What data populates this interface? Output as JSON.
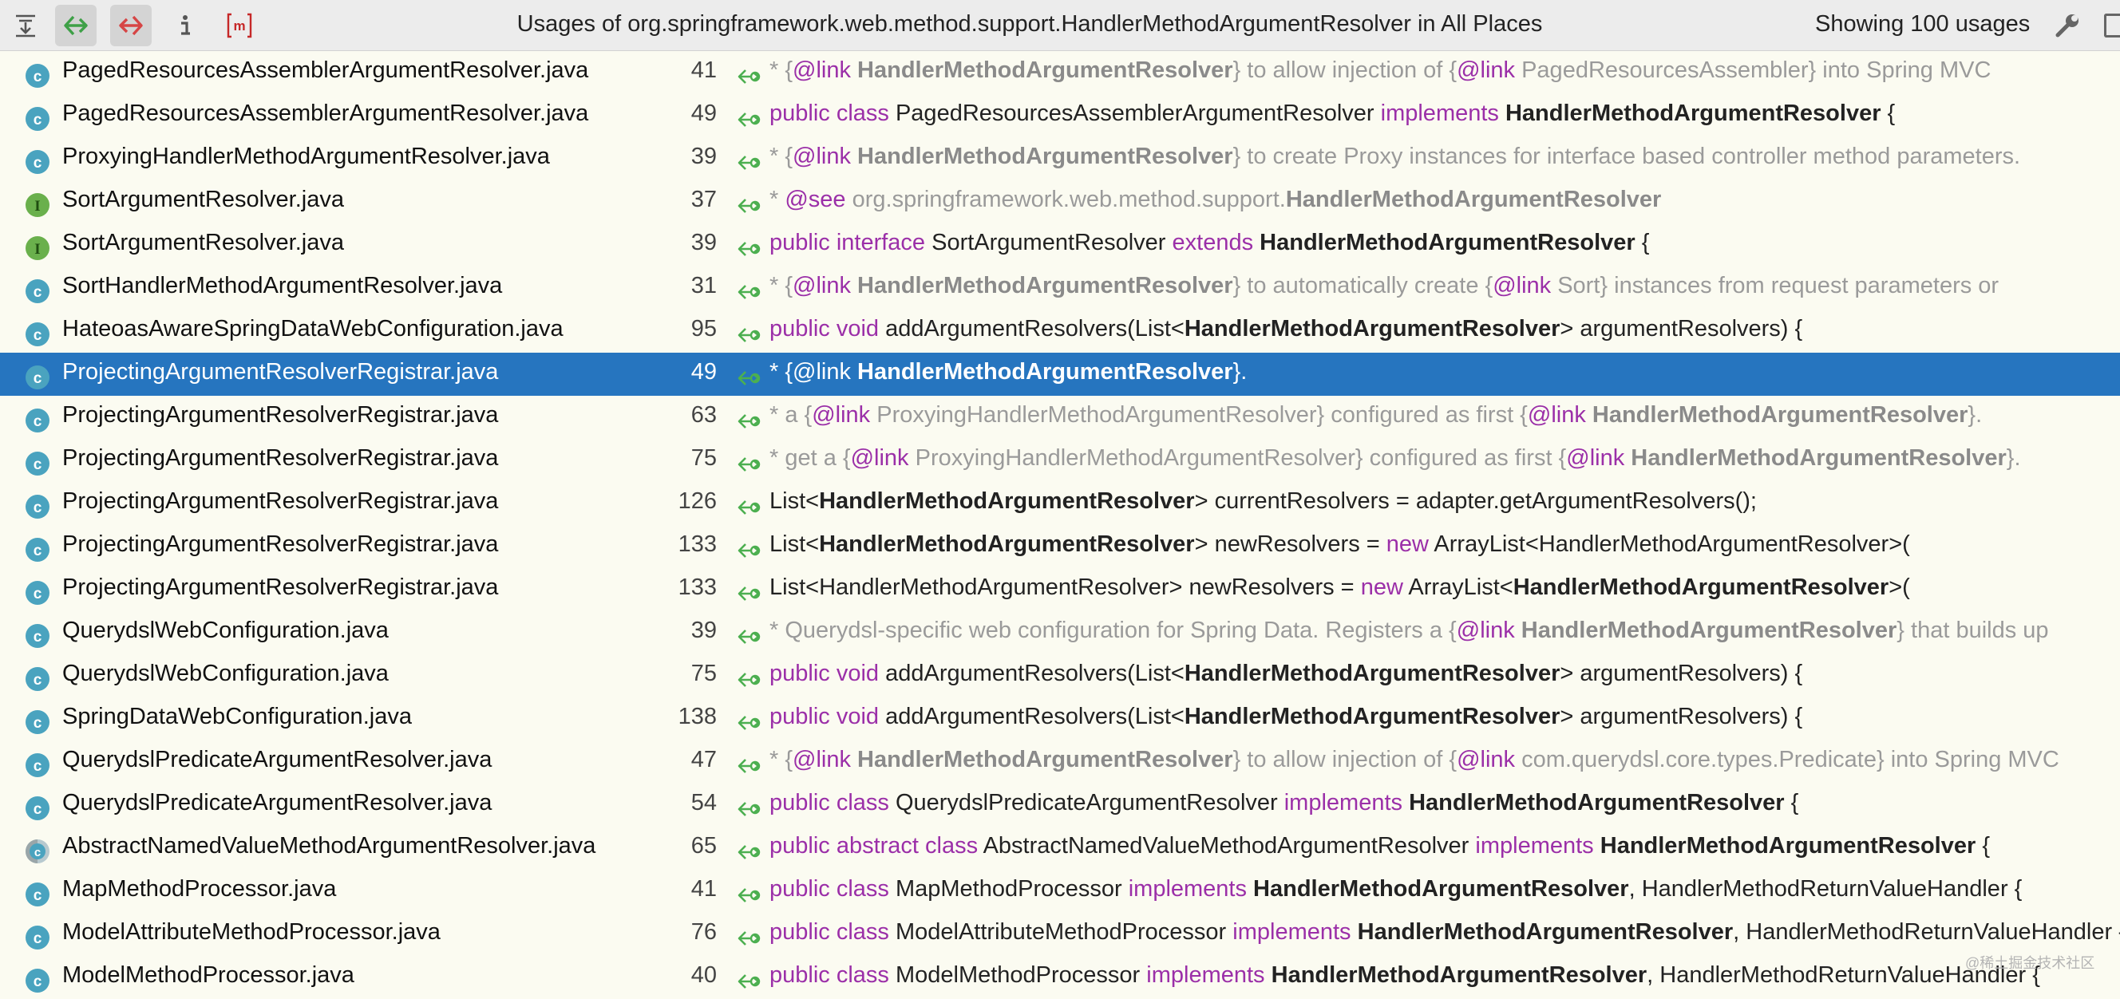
{
  "toolbar": {
    "title": "Usages of org.springframework.web.method.support.HandlerMethodArgumentResolver in All Places",
    "count_text": "Showing 100 usages",
    "buttons": [
      {
        "icon": "expand-all-icon"
      },
      {
        "icon": "previous-occurrence-icon"
      },
      {
        "icon": "next-occurrence-icon"
      },
      {
        "icon": "info-icon"
      },
      {
        "icon": "method-icon"
      },
      {
        "icon": "settings-wrench-icon"
      }
    ]
  },
  "colors": {
    "selection": "#2675bf",
    "keyword": "#9b2fa8",
    "background": "#fbfbf1",
    "class_icon": "#4aa3bf",
    "interface_icon": "#6ab04c",
    "usage_arrow": "#4caf50"
  },
  "rows": [
    {
      "file": "PagedResourcesAssemblerArgumentResolver.java",
      "icon": "class",
      "line": "41",
      "code": [
        [
          "doc",
          " * {"
        ],
        [
          "doctag",
          "@link"
        ],
        [
          "dochit",
          " HandlerMethodArgumentResolver"
        ],
        [
          "doc",
          "} to allow injection of {"
        ],
        [
          "doctag",
          "@link"
        ],
        [
          "doc",
          " PagedResourcesAssembler} into Spring MVC"
        ]
      ]
    },
    {
      "file": "PagedResourcesAssemblerArgumentResolver.java",
      "icon": "class",
      "line": "49",
      "code": [
        [
          "kw",
          "public class"
        ],
        [
          "txt",
          " PagedResourcesAssemblerArgumentResolver "
        ],
        [
          "kw",
          "implements"
        ],
        [
          "hit",
          " HandlerMethodArgumentResolver"
        ],
        [
          "txt",
          " {"
        ]
      ]
    },
    {
      "file": "ProxyingHandlerMethodArgumentResolver.java",
      "icon": "class",
      "line": "39",
      "code": [
        [
          "doc",
          " * {"
        ],
        [
          "doctag",
          "@link"
        ],
        [
          "dochit",
          " HandlerMethodArgumentResolver"
        ],
        [
          "doc",
          "} to create Proxy instances for interface based controller method parameters."
        ]
      ]
    },
    {
      "file": "SortArgumentResolver.java",
      "icon": "interface",
      "line": "37",
      "code": [
        [
          "doc",
          " * "
        ],
        [
          "doctag",
          "@see"
        ],
        [
          "doc",
          " org.springframework.web.method.support."
        ],
        [
          "dochit",
          "HandlerMethodArgumentResolver"
        ]
      ]
    },
    {
      "file": "SortArgumentResolver.java",
      "icon": "interface",
      "line": "39",
      "code": [
        [
          "kw",
          "public interface"
        ],
        [
          "txt",
          " SortArgumentResolver "
        ],
        [
          "kw",
          "extends"
        ],
        [
          "hit",
          " HandlerMethodArgumentResolver"
        ],
        [
          "txt",
          " {"
        ]
      ]
    },
    {
      "file": "SortHandlerMethodArgumentResolver.java",
      "icon": "class",
      "line": "31",
      "code": [
        [
          "doc",
          " * {"
        ],
        [
          "doctag",
          "@link"
        ],
        [
          "dochit",
          " HandlerMethodArgumentResolver"
        ],
        [
          "doc",
          "} to automatically create {"
        ],
        [
          "doctag",
          "@link"
        ],
        [
          "doc",
          " Sort} instances from request parameters or"
        ]
      ]
    },
    {
      "file": "HateoasAwareSpringDataWebConfiguration.java",
      "icon": "class",
      "line": "95",
      "code": [
        [
          "kw",
          "public void"
        ],
        [
          "txt",
          " addArgumentResolvers(List<"
        ],
        [
          "hit",
          "HandlerMethodArgumentResolver"
        ],
        [
          "txt",
          "> argumentResolvers) {"
        ]
      ]
    },
    {
      "file": "ProjectingArgumentResolverRegistrar.java",
      "icon": "class",
      "line": "49",
      "selected": true,
      "code": [
        [
          "doc",
          " * {"
        ],
        [
          "doctag",
          "@link"
        ],
        [
          "dochit",
          " HandlerMethodArgumentResolver"
        ],
        [
          "doc",
          "}."
        ]
      ]
    },
    {
      "file": "ProjectingArgumentResolverRegistrar.java",
      "icon": "class",
      "line": "63",
      "code": [
        [
          "doc",
          " * a {"
        ],
        [
          "doctag",
          "@link"
        ],
        [
          "doc",
          " ProxyingHandlerMethodArgumentResolver} configured as first {"
        ],
        [
          "doctag",
          "@link"
        ],
        [
          "dochit",
          " HandlerMethodArgumentResolver"
        ],
        [
          "doc",
          "}."
        ]
      ]
    },
    {
      "file": "ProjectingArgumentResolverRegistrar.java",
      "icon": "class",
      "line": "75",
      "code": [
        [
          "doc",
          " * get a {"
        ],
        [
          "doctag",
          "@link"
        ],
        [
          "doc",
          " ProxyingHandlerMethodArgumentResolver} configured as first {"
        ],
        [
          "doctag",
          "@link"
        ],
        [
          "dochit",
          " HandlerMethodArgumentResolver"
        ],
        [
          "doc",
          "}."
        ]
      ]
    },
    {
      "file": "ProjectingArgumentResolverRegistrar.java",
      "icon": "class",
      "line": "126",
      "code": [
        [
          "txt",
          "List<"
        ],
        [
          "hit",
          "HandlerMethodArgumentResolver"
        ],
        [
          "txt",
          "> currentResolvers = adapter.getArgumentResolvers();"
        ]
      ]
    },
    {
      "file": "ProjectingArgumentResolverRegistrar.java",
      "icon": "class",
      "line": "133",
      "code": [
        [
          "txt",
          "List<"
        ],
        [
          "hit",
          "HandlerMethodArgumentResolver"
        ],
        [
          "txt",
          "> newResolvers = "
        ],
        [
          "kw",
          "new"
        ],
        [
          "txt",
          " ArrayList<HandlerMethodArgumentResolver>("
        ]
      ]
    },
    {
      "file": "ProjectingArgumentResolverRegistrar.java",
      "icon": "class",
      "line": "133",
      "code": [
        [
          "txt",
          "List<HandlerMethodArgumentResolver> newResolvers = "
        ],
        [
          "kw",
          "new"
        ],
        [
          "txt",
          " ArrayList<"
        ],
        [
          "hit",
          "HandlerMethodArgumentResolver"
        ],
        [
          "txt",
          ">("
        ]
      ]
    },
    {
      "file": "QuerydslWebConfiguration.java",
      "icon": "class",
      "line": "39",
      "code": [
        [
          "doc",
          " * Querydsl-specific web configuration for Spring Data. Registers a {"
        ],
        [
          "doctag",
          "@link"
        ],
        [
          "dochit",
          " HandlerMethodArgumentResolver"
        ],
        [
          "doc",
          "} that builds up"
        ]
      ]
    },
    {
      "file": "QuerydslWebConfiguration.java",
      "icon": "class",
      "line": "75",
      "code": [
        [
          "kw",
          "public void"
        ],
        [
          "txt",
          " addArgumentResolvers(List<"
        ],
        [
          "hit",
          "HandlerMethodArgumentResolver"
        ],
        [
          "txt",
          "> argumentResolvers) {"
        ]
      ]
    },
    {
      "file": "SpringDataWebConfiguration.java",
      "icon": "class",
      "line": "138",
      "code": [
        [
          "kw",
          "public void"
        ],
        [
          "txt",
          " addArgumentResolvers(List<"
        ],
        [
          "hit",
          "HandlerMethodArgumentResolver"
        ],
        [
          "txt",
          "> argumentResolvers) {"
        ]
      ]
    },
    {
      "file": "QuerydslPredicateArgumentResolver.java",
      "icon": "class",
      "line": "47",
      "code": [
        [
          "doc",
          " * {"
        ],
        [
          "doctag",
          "@link"
        ],
        [
          "dochit",
          " HandlerMethodArgumentResolver"
        ],
        [
          "doc",
          "} to allow injection of {"
        ],
        [
          "doctag",
          "@link"
        ],
        [
          "doc",
          " com.querydsl.core.types.Predicate} into Spring MVC"
        ]
      ]
    },
    {
      "file": "QuerydslPredicateArgumentResolver.java",
      "icon": "class",
      "line": "54",
      "code": [
        [
          "kw",
          "public class"
        ],
        [
          "txt",
          " QuerydslPredicateArgumentResolver "
        ],
        [
          "kw",
          "implements"
        ],
        [
          "hit",
          " HandlerMethodArgumentResolver"
        ],
        [
          "txt",
          " {"
        ]
      ]
    },
    {
      "file": "AbstractNamedValueMethodArgumentResolver.java",
      "icon": "abstract",
      "line": "65",
      "code": [
        [
          "kw",
          "public abstract class"
        ],
        [
          "txt",
          " AbstractNamedValueMethodArgumentResolver "
        ],
        [
          "kw",
          "implements"
        ],
        [
          "hit",
          " HandlerMethodArgumentResolver"
        ],
        [
          "txt",
          " {"
        ]
      ]
    },
    {
      "file": "MapMethodProcessor.java",
      "icon": "class",
      "line": "41",
      "code": [
        [
          "kw",
          "public class"
        ],
        [
          "txt",
          " MapMethodProcessor "
        ],
        [
          "kw",
          "implements"
        ],
        [
          "hit",
          " HandlerMethodArgumentResolver"
        ],
        [
          "txt",
          ", HandlerMethodReturnValueHandler {"
        ]
      ]
    },
    {
      "file": "ModelAttributeMethodProcessor.java",
      "icon": "class",
      "line": "76",
      "code": [
        [
          "kw",
          "public class"
        ],
        [
          "txt",
          " ModelAttributeMethodProcessor "
        ],
        [
          "kw",
          "implements"
        ],
        [
          "hit",
          " HandlerMethodArgumentResolver"
        ],
        [
          "txt",
          ", HandlerMethodReturnValueHandler {"
        ]
      ]
    },
    {
      "file": "ModelMethodProcessor.java",
      "icon": "class",
      "line": "40",
      "code": [
        [
          "kw",
          "public class"
        ],
        [
          "txt",
          " ModelMethodProcessor "
        ],
        [
          "kw",
          "implements"
        ],
        [
          "hit",
          " HandlerMethodArgumentResolver"
        ],
        [
          "txt",
          ", HandlerMethodReturnValueHandler {"
        ]
      ]
    }
  ],
  "watermark": "@稀土掘金技术社区"
}
